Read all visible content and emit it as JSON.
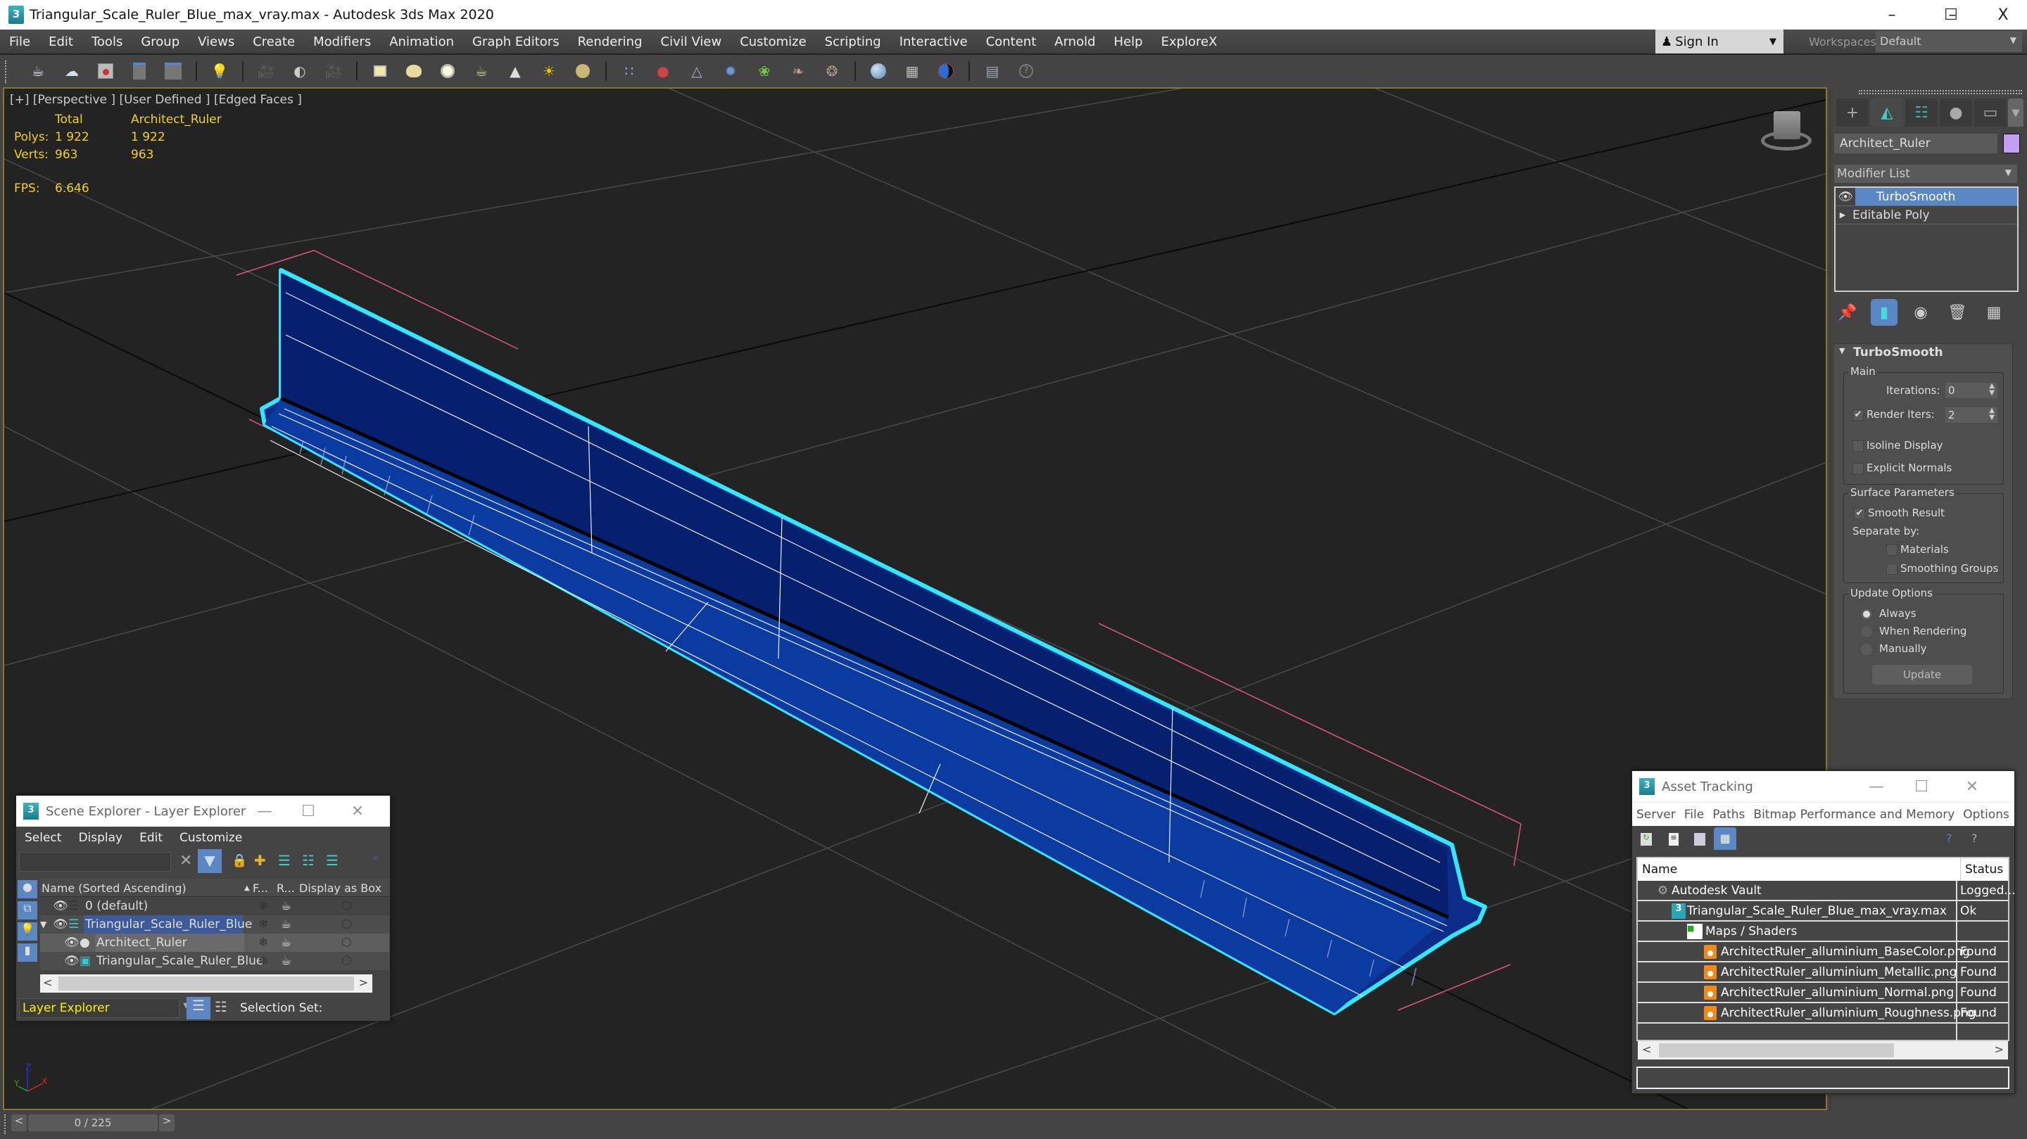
{
  "window": {
    "title": "Triangular_Scale_Ruler_Blue_max_vray.max - Autodesk 3ds Max 2020",
    "logo": "3",
    "controls": {
      "minimize": "–",
      "maximize": "☐",
      "close": "X"
    }
  },
  "menubar": {
    "items": [
      "File",
      "Edit",
      "Tools",
      "Group",
      "Views",
      "Create",
      "Modifiers",
      "Animation",
      "Graph Editors",
      "Rendering",
      "Civil View",
      "Customize",
      "Scripting",
      "Interactive",
      "Content",
      "Arnold",
      "Help",
      "ExploreX"
    ],
    "signin": "Sign In",
    "workspaces_label": "Workspaces:",
    "workspace": "Default"
  },
  "toolbar": {
    "icons": [
      "teapot-icon",
      "cloud-icon",
      "render-frame-icon",
      "panel-list-icon",
      "panel-grid-icon",
      "light-lister-icon",
      "camera-icon",
      "camera-sequence-icon",
      "film-camera-icon",
      "plane-light-icon",
      "sphere-light-icon",
      "dome-light-icon",
      "mesh-light-icon",
      "ies-light-icon",
      "sun-icon",
      "ambient-light-icon",
      "particles-icon",
      "molecule-icon",
      "tower-icon",
      "virus-icon",
      "fur-icon",
      "hair-hf-icon",
      "hair-ox-icon",
      "material-sphere-icon",
      "material-browser-icon",
      "render-region-icon",
      "scene-converter-icon",
      "help-icon"
    ]
  },
  "viewport": {
    "label": "[+] [Perspective ] [User Defined ] [Edged Faces ]",
    "stats": {
      "col_total": "Total",
      "col_object": "Architect_Ruler",
      "polys_label": "Polys:",
      "polys_total": "1 922",
      "polys_object": "1 922",
      "verts_label": "Verts:",
      "verts_total": "963",
      "verts_object": "963",
      "fps_label": "FPS:",
      "fps_value": "6.646"
    },
    "axis": {
      "x": "X",
      "y": "Y",
      "z": "Z"
    }
  },
  "command_panel": {
    "object_name": "Architect_Ruler",
    "object_color": "#c49ef2",
    "modifier_list": "Modifier List",
    "stack": [
      {
        "label": "TurboSmooth",
        "selected": true
      },
      {
        "label": "Editable Poly",
        "selected": false
      }
    ],
    "rollout": {
      "title": "TurboSmooth",
      "main_group": "Main",
      "iterations_label": "Iterations:",
      "iterations_value": "0",
      "render_iters_label": "Render Iters:",
      "render_iters_checked": true,
      "render_iters_value": "2",
      "isoline_label": "Isoline Display",
      "explicit_normals_label": "Explicit Normals",
      "surface_group": "Surface Parameters",
      "smooth_result_label": "Smooth Result",
      "separate_by_label": "Separate by:",
      "materials_label": "Materials",
      "smoothing_groups_label": "Smoothing Groups",
      "update_group": "Update Options",
      "update_options": [
        "Always",
        "When Rendering",
        "Manually"
      ],
      "update_selected": "Always",
      "update_button": "Update"
    }
  },
  "scene_explorer": {
    "title": "Scene Explorer - Layer Explorer",
    "menu": [
      "Select",
      "Display",
      "Edit",
      "Customize"
    ],
    "search_value": "",
    "columns": [
      "Name (Sorted Ascending)",
      "F...",
      "R...",
      "Display as Box"
    ],
    "rows": [
      {
        "name": "0 (default)",
        "type": "layer",
        "indent": 0
      },
      {
        "name": "Triangular_Scale_Ruler_Blue",
        "type": "layer",
        "indent": 0,
        "expanded": true,
        "selected": true
      },
      {
        "name": "Architect_Ruler",
        "type": "object",
        "indent": 1,
        "highlighted": true
      },
      {
        "name": "Triangular_Scale_Ruler_Blue",
        "type": "group",
        "indent": 1
      }
    ],
    "explorer_mode": "Layer Explorer",
    "selection_set_label": "Selection Set:"
  },
  "asset_tracking": {
    "title": "Asset Tracking",
    "menu": [
      "Server",
      "File",
      "Paths",
      "Bitmap Performance and Memory",
      "Options"
    ],
    "columns": [
      "Name",
      "Status"
    ],
    "rows": [
      {
        "name": "Autodesk Vault",
        "status": "Logged...",
        "indent": 0,
        "icon": "vault-icon"
      },
      {
        "name": "Triangular_Scale_Ruler_Blue_max_vray.max",
        "status": "Ok",
        "indent": 1,
        "icon": "max-file-icon"
      },
      {
        "name": "Maps / Shaders",
        "status": "",
        "indent": 2,
        "icon": "maps-icon"
      },
      {
        "name": "ArchitectRuler_alluminium_BaseColor.png",
        "status": "Found",
        "indent": 3,
        "icon": "png-icon"
      },
      {
        "name": "ArchitectRuler_alluminium_Metallic.png",
        "status": "Found",
        "indent": 3,
        "icon": "png-icon"
      },
      {
        "name": "ArchitectRuler_alluminium_Normal.png",
        "status": "Found",
        "indent": 3,
        "icon": "png-icon"
      },
      {
        "name": "ArchitectRuler_alluminium_Roughness.png",
        "status": "Found",
        "indent": 3,
        "icon": "png-icon"
      }
    ]
  },
  "timeline": {
    "frame": "0 / 225",
    "prev": "<",
    "next": ">"
  }
}
